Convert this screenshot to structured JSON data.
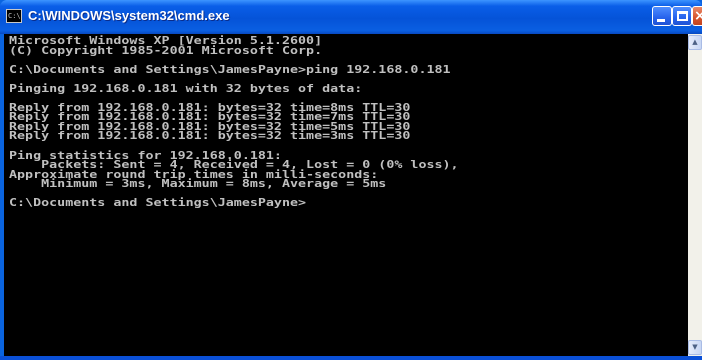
{
  "window": {
    "title": "C:\\WINDOWS\\system32\\cmd.exe",
    "icon": "cmd-icon",
    "controls": {
      "minimize": "minimize-icon",
      "maximize": "maximize-icon",
      "close": "close-icon"
    }
  },
  "console": {
    "lines": [
      "Microsoft Windows XP [Version 5.1.2600]",
      "(C) Copyright 1985-2001 Microsoft Corp.",
      "",
      "C:\\Documents and Settings\\JamesPayne>ping 192.168.0.181",
      "",
      "Pinging 192.168.0.181 with 32 bytes of data:",
      "",
      "Reply from 192.168.0.181: bytes=32 time=8ms TTL=30",
      "Reply from 192.168.0.181: bytes=32 time=7ms TTL=30",
      "Reply from 192.168.0.181: bytes=32 time=5ms TTL=30",
      "Reply from 192.168.0.181: bytes=32 time=3ms TTL=30",
      "",
      "Ping statistics for 192.168.0.181:",
      "    Packets: Sent = 4, Received = 4, Lost = 0 (0% loss),",
      "Approximate round trip times in milli-seconds:",
      "    Minimum = 3ms, Maximum = 8ms, Average = 5ms",
      "",
      "C:\\Documents and Settings\\JamesPayne>"
    ]
  },
  "colors": {
    "titlebar": "#0553d8",
    "console_background": "#000000",
    "console_text": "#c0c0c0",
    "close_button": "#d6532c"
  }
}
